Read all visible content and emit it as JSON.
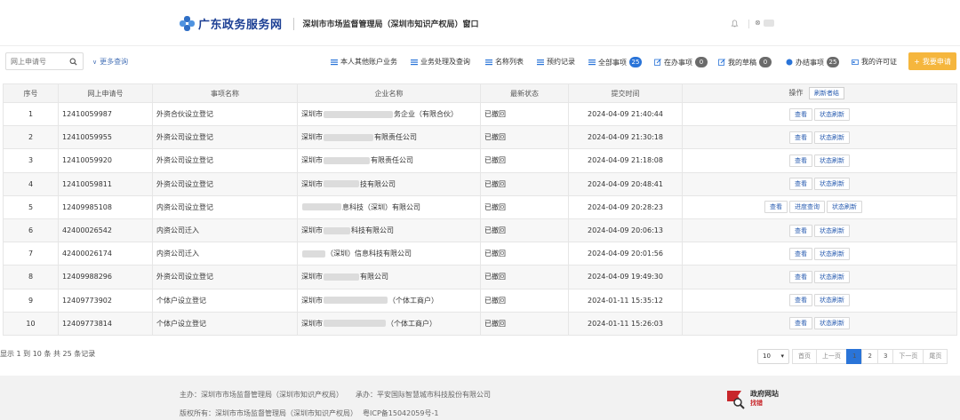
{
  "header": {
    "site_name": "广东政务服务网",
    "dept_title": "深圳市市场监督管理局（深圳市知识产权局）窗口",
    "user_prefix": "⊗"
  },
  "toolbar": {
    "search_placeholder": "网上申请号",
    "more_search": "更多查询",
    "items": [
      {
        "label": "本人其他账户业务",
        "icon": "list-icon"
      },
      {
        "label": "业务处理及查询",
        "icon": "list-icon"
      },
      {
        "label": "名称列表",
        "icon": "list-icon"
      },
      {
        "label": "预约记录",
        "icon": "list-icon"
      },
      {
        "label": "全部事项",
        "icon": "list-icon",
        "badge": "25"
      },
      {
        "label": "在办事项",
        "icon": "edit-icon",
        "badge": "0"
      },
      {
        "label": "我的草稿",
        "icon": "edit-icon",
        "badge": "0"
      },
      {
        "label": "办结事项",
        "icon": "circle-icon",
        "badge": "25"
      },
      {
        "label": "我的许可证",
        "icon": "card-icon"
      }
    ],
    "apply_label": "我要申请"
  },
  "table": {
    "headers": [
      "序号",
      "网上申请号",
      "事项名称",
      "企业名称",
      "最新状态",
      "提交时间",
      "操作"
    ],
    "refresh_all": "刷新者结",
    "rows": [
      {
        "no": "1",
        "app_no": "12410059987",
        "item": "外资合伙设立登记",
        "company_pre": "深圳市",
        "company_post": "务企业（有限合伙）",
        "status": "已撤回",
        "time": "2024-04-09 21:40:44",
        "ops": [
          "查看",
          "状态刷新"
        ]
      },
      {
        "no": "2",
        "app_no": "12410059955",
        "item": "外资公司设立登记",
        "company_pre": "深圳市",
        "company_post": "有限责任公司",
        "status": "已撤回",
        "time": "2024-04-09 21:30:18",
        "ops": [
          "查看",
          "状态刷新"
        ]
      },
      {
        "no": "3",
        "app_no": "12410059920",
        "item": "外资公司设立登记",
        "company_pre": "深圳市",
        "company_post": "有限责任公司",
        "status": "已撤回",
        "time": "2024-04-09 21:18:08",
        "ops": [
          "查看",
          "状态刷新"
        ]
      },
      {
        "no": "4",
        "app_no": "12410059811",
        "item": "外资公司设立登记",
        "company_pre": "深圳市",
        "company_post": "技有限公司",
        "status": "已撤回",
        "time": "2024-04-09 20:48:41",
        "ops": [
          "查看",
          "状态刷新"
        ]
      },
      {
        "no": "5",
        "app_no": "12409985108",
        "item": "内资公司设立登记",
        "company_pre": "",
        "company_post": "息科技（深圳）有限公司",
        "status": "已撤回",
        "time": "2024-04-09 20:28:23",
        "ops": [
          "查看",
          "进度查询",
          "状态刷新"
        ]
      },
      {
        "no": "6",
        "app_no": "42400026542",
        "item": "内资公司迁入",
        "company_pre": "深圳市",
        "company_post": "科技有限公司",
        "status": "已撤回",
        "time": "2024-04-09 20:06:13",
        "ops": [
          "查看",
          "状态刷新"
        ]
      },
      {
        "no": "7",
        "app_no": "42400026174",
        "item": "内资公司迁入",
        "company_pre": "",
        "company_post": "（深圳）信息科技有限公司",
        "status": "已撤回",
        "time": "2024-04-09 20:01:56",
        "ops": [
          "查看",
          "状态刷新"
        ]
      },
      {
        "no": "8",
        "app_no": "12409988296",
        "item": "外资公司设立登记",
        "company_pre": "深圳市",
        "company_post": "有限公司",
        "status": "已撤回",
        "time": "2024-04-09 19:49:30",
        "ops": [
          "查看",
          "状态刷新"
        ]
      },
      {
        "no": "9",
        "app_no": "12409773902",
        "item": "个体户设立登记",
        "company_pre": "深圳市",
        "company_post": "（个体工商户）",
        "status": "已撤回",
        "time": "2024-01-11 15:35:12",
        "ops": [
          "查看",
          "状态刷新"
        ]
      },
      {
        "no": "10",
        "app_no": "12409773814",
        "item": "个体户设立登记",
        "company_pre": "深圳市",
        "company_post": "（个体工商户）",
        "status": "已撤回",
        "time": "2024-01-11 15:26:03",
        "ops": [
          "查看",
          "状态刷新"
        ]
      }
    ]
  },
  "pagination": {
    "summary": "显示 1 到 10 条 共 25 条记录",
    "page_size": "10",
    "first": "首页",
    "prev": "上一页",
    "pages": [
      "1",
      "2",
      "3"
    ],
    "current": "1",
    "next": "下一页",
    "last": "尾页"
  },
  "footer": {
    "host": "主办：深圳市市场监督管理局（深圳市知识产权局）",
    "operator": "承办：平安国际智慧城市科技股份有限公司",
    "copyright": "版权所有：深圳市市场监督管理局（深圳市知识产权局）",
    "icp": "粤ICP备15042059号-1",
    "gov_logo_line1": "政府网站",
    "gov_logo_line2": "找错"
  },
  "colors": {
    "brand_blue": "#1c3f94",
    "badge_blue": "#2a74d8",
    "apply_orange": "#f5b63d"
  }
}
